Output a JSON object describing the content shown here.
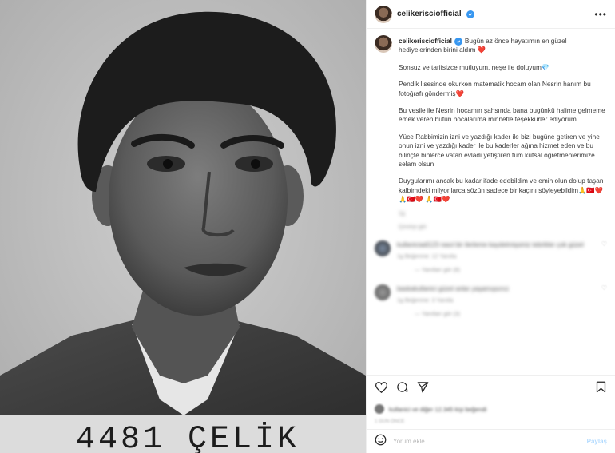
{
  "header": {
    "username": "celikerisciofficial",
    "more_label": "•••"
  },
  "caption": {
    "username": "celikerisciofficial",
    "paragraphs": [
      "Bugün az önce hayatımın en güzel hediyelerinden birini aldım ❤️",
      "Sonsuz ve tarifsizce mutluyum, neşe ile doluyum💎",
      "Pendik lisesinde okurken matematik hocam olan Nesrin hanım bu fotoğrafı göndermiş❤️",
      "Bu vesile ile Nesrin hocamın şahsında bana bugünkü halime gelmeme emek veren bütün hocalarıma minnetle teşekkürler ediyorum",
      "Yüce Rabbimizin izni ve yazdığı kader ile bizi bugüne getiren ve yine onun izni ve yazdığı kader ile bu kaderler ağına hizmet eden ve bu bilinçte binlerce vatan evladı yetiştiren tüm kutsal öğretmenlerimize selam olsun",
      "Duygularımı ancak bu kadar ifade edebildim ve emin olun dolup taşan kalbimdeki milyonlarca sözün sadece bir kaçını söyleyebildim🙏🇹🇷❤️ 🙏🇹🇷❤️ 🙏🇹🇷❤️"
    ],
    "time": "1g",
    "translation": "Çeviriyi gör"
  },
  "comments": [
    {
      "text": "kullaniciadi123 nasıl bir ilerleme kaydetmişsiniz tebrikler çok güzel",
      "sub": "1g   Beğenme: 12   Yanıtla",
      "replies": "— Yanıtları gör (8)"
    },
    {
      "text": "baskakullanici güzel anlar yaşamışsınız",
      "sub": "1g   Beğenme: 3   Yanıtla",
      "replies": "— Yanıtları gör (3)"
    }
  ],
  "likes": {
    "text": "kullanici ve diğer 12.345 kişi beğendi"
  },
  "date": "1 GÜN ÖNCE",
  "add_comment": {
    "placeholder": "Yorum ekle...",
    "post_label": "Paylaş"
  },
  "photo": {
    "plate_text": "4481 ÇELİK"
  }
}
